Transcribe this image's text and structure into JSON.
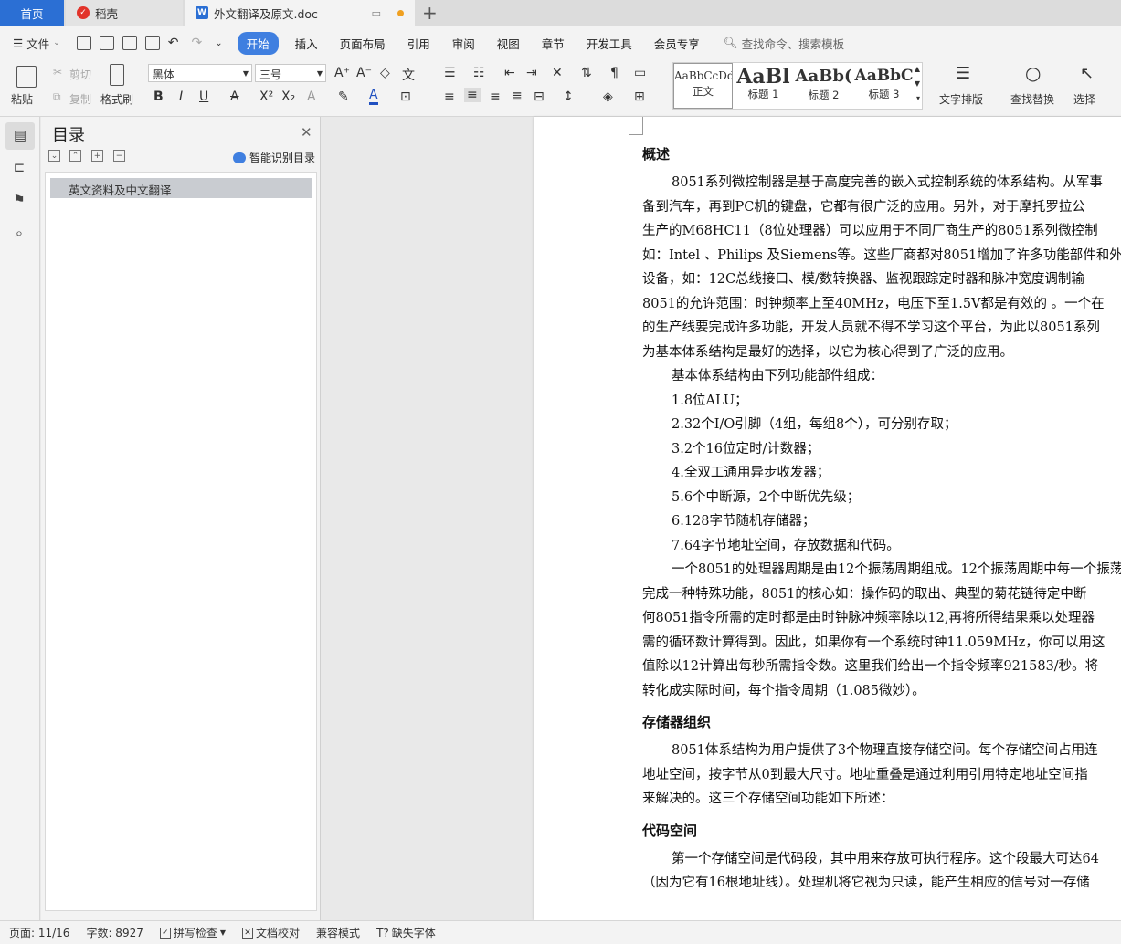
{
  "tabs": {
    "home": "首页",
    "daoke": "稻壳",
    "doc": "外文翻译及原文.doc"
  },
  "menu": {
    "file": "文件",
    "items": [
      "开始",
      "插入",
      "页面布局",
      "引用",
      "审阅",
      "视图",
      "章节",
      "开发工具",
      "会员专享"
    ],
    "search": "查找命令、搜索模板"
  },
  "ribbon": {
    "paste": "粘贴",
    "cut": "剪切",
    "copy": "复制",
    "format_painter": "格式刷",
    "font_name": "黑体",
    "font_size": "三号",
    "styles": [
      {
        "sample": "AaBbCcDd",
        "label": "正文"
      },
      {
        "sample": "AaBl",
        "label": "标题 1"
      },
      {
        "sample": "AaBb(",
        "label": "标题 2"
      },
      {
        "sample": "AaBbC",
        "label": "标题 3"
      }
    ],
    "text_layout": "文字排版",
    "find_replace": "查找替换",
    "select": "选择"
  },
  "toc": {
    "title": "目录",
    "smart": "智能识别目录",
    "entries": [
      "英文资料及中文翻译"
    ]
  },
  "document": {
    "h1": "概述",
    "p1": [
      "8051系列微控制器是基于高度完善的嵌入式控制系统的体系结构。从军事",
      "备到汽车，再到PC机的键盘，它都有很广泛的应用。另外，对于摩托罗拉公",
      "生产的M68HC11（8位处理器）可以应用于不同厂商生产的8051系列微控制",
      "如：Intel 、Philips 及Siemens等。这些厂商都对8051增加了许多功能部件和外",
      "设备，如：12C总线接口、模/数转换器、监视跟踪定时器和脉冲宽度调制输",
      "8051的允许范围：时钟频率上至40MHz，电压下至1.5V都是有效的 。一个在",
      "的生产线要完成许多功能，开发人员就不得不学习这个平台，为此以8051系列",
      "为基本体系结构是最好的选择，以它为核心得到了广泛的应用。"
    ],
    "p2": "基本体系结构由下列功能部件组成：",
    "list": [
      "1.8位ALU；",
      "2.32个I/O引脚（4组，每组8个），可分别存取；",
      "3.2个16位定时/计数器；",
      "4.全双工通用异步收发器；",
      "5.6个中断源，2个中断优先级；",
      "6.128字节随机存储器；",
      "7.64字节地址空间，存放数据和代码。"
    ],
    "p3": [
      "一个8051的处理器周期是由12个振荡周期组成。12个振荡周期中每一个振荡",
      "完成一种特殊功能，8051的核心如：操作码的取出、典型的菊花链待定中断",
      "何8051指令所需的定时都是由时钟脉冲频率除以12,再将所得结果乘以处理器",
      "需的循环数计算得到。因此，如果你有一个系统时钟11.059MHz，你可以用这",
      "值除以12计算出每秒所需指令数。这里我们给出一个指令频率921583/秒。将",
      "转化成实际时间，每个指令周期（1.085微妙）。"
    ],
    "h2": "存储器组织",
    "p4": [
      "8051体系结构为用户提供了3个物理直接存储空间。每个存储空间占用连",
      "地址空间，按字节从0到最大尺寸。地址重叠是通过利用引用特定地址空间指",
      "来解决的。这三个存储空间功能如下所述："
    ],
    "h3": "代码空间",
    "p5": [
      "第一个存储空间是代码段，其中用来存放可执行程序。这个段最大可达64",
      "（因为它有16根地址线）。处理机将它视为只读，能产生相应的信号对一存储"
    ]
  },
  "status": {
    "page": "页面: 11/16",
    "words": "字数: 8927",
    "spell": "拼写检查",
    "proof": "文档校对",
    "compat": "兼容模式",
    "missing_font": "缺失字体"
  }
}
